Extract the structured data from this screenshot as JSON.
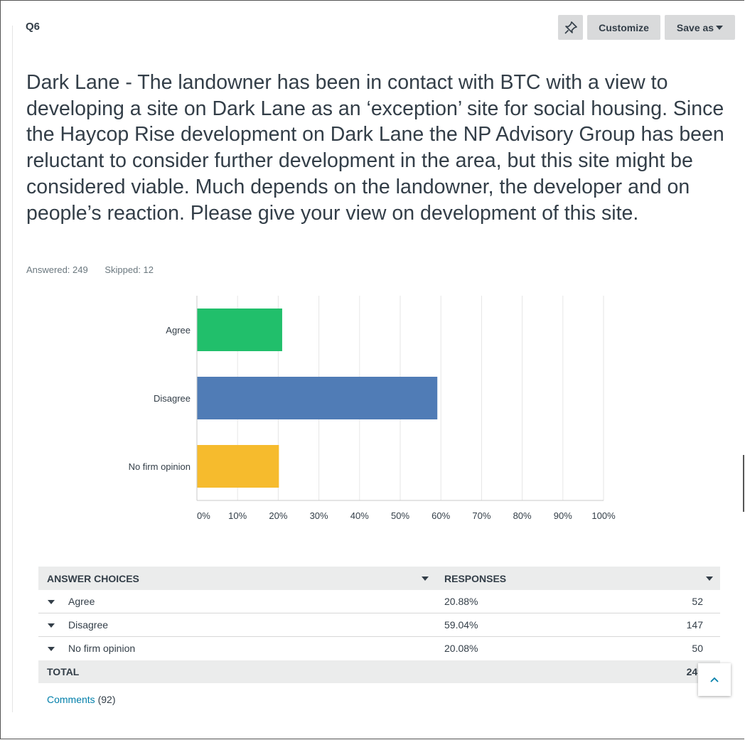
{
  "question": {
    "number": "Q6",
    "text": "Dark Lane - The landowner has been in contact with BTC with a view to developing a site on Dark Lane as an ‘exception’ site for social housing. Since the Haycop Rise development on Dark Lane the NP Advisory Group has been reluctant to consider further development in the area, but this site might be considered viable. Much depends on the landowner, the developer and on people’s reaction. Please give your view on development of this site."
  },
  "toolbar": {
    "pin_icon": "pin-icon",
    "customize_label": "Customize",
    "save_as_label": "Save as"
  },
  "stats": {
    "answered": "Answered: 249",
    "skipped": "Skipped: 12"
  },
  "chart_data": {
    "type": "bar",
    "orientation": "horizontal",
    "categories": [
      "Agree",
      "Disagree",
      "No firm opinion"
    ],
    "values": [
      20.88,
      59.04,
      20.08
    ],
    "colors": [
      "#21bf6b",
      "#507cb6",
      "#f6bb2d"
    ],
    "xlim": [
      0,
      100
    ],
    "x_ticks": [
      "0%",
      "10%",
      "20%",
      "30%",
      "40%",
      "50%",
      "60%",
      "70%",
      "80%",
      "90%",
      "100%"
    ],
    "grid": true
  },
  "table": {
    "headers": {
      "answer_choices": "ANSWER CHOICES",
      "responses": "RESPONSES"
    },
    "rows": [
      {
        "label": "Agree",
        "percent": "20.88%",
        "count": "52"
      },
      {
        "label": "Disagree",
        "percent": "59.04%",
        "count": "147"
      },
      {
        "label": "No firm opinion",
        "percent": "20.08%",
        "count": "50"
      }
    ],
    "total_label": "TOTAL",
    "total_count": "249"
  },
  "comments": {
    "link_label": "Comments",
    "count": "(92)"
  },
  "scroll_top": {
    "icon": "chevron-up-icon",
    "glyph": "^"
  }
}
